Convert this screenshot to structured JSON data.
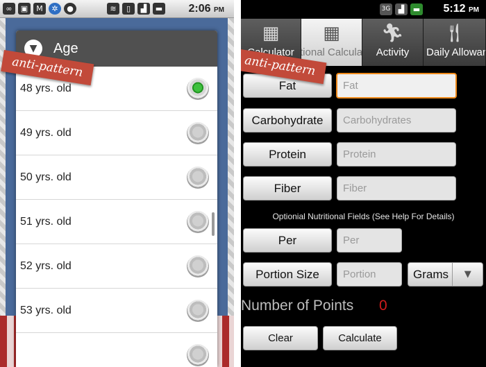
{
  "left": {
    "status_bar": {
      "icons": [
        "voicemail-icon",
        "photo-icon",
        "gmail-icon",
        "settings-icon",
        "media-icon",
        "wifi-icon",
        "vibrate-icon",
        "signal-icon",
        "battery-icon"
      ],
      "time": "2:06",
      "ampm": "PM"
    },
    "dialog": {
      "title": "Age",
      "items": [
        {
          "label": "48 yrs. old",
          "selected": true
        },
        {
          "label": "49 yrs. old",
          "selected": false
        },
        {
          "label": "50 yrs. old",
          "selected": false
        },
        {
          "label": "51 yrs. old",
          "selected": false
        },
        {
          "label": "52 yrs. old",
          "selected": false
        },
        {
          "label": "53 yrs. old",
          "selected": false
        }
      ]
    },
    "tag": "anti-pattern"
  },
  "right": {
    "status_bar": {
      "icons": [
        "3g-icon",
        "signal-icon",
        "battery-icon"
      ],
      "network": "3G",
      "time": "5:12",
      "ampm": "PM"
    },
    "tabs": [
      {
        "label": "Calculator",
        "icon": "calculator-icon",
        "active": false
      },
      {
        "label": "Optional Calculator",
        "icon": "calculator-icon",
        "active": true
      },
      {
        "label": "Activity",
        "icon": "runner-icon",
        "active": false
      },
      {
        "label": "Daily Allowance",
        "icon": "fork-knife-icon",
        "active": false
      }
    ],
    "fields": [
      {
        "button": "Fat",
        "placeholder": "Fat"
      },
      {
        "button": "Carbohydrate",
        "placeholder": "Carbohydrates"
      },
      {
        "button": "Protein",
        "placeholder": "Protein"
      },
      {
        "button": "Fiber",
        "placeholder": "Fiber"
      }
    ],
    "optional_note": "Optionial Nutritional Fields (See Help For Details)",
    "per": {
      "button": "Per",
      "placeholder": "Per"
    },
    "portion": {
      "button": "Portion Size",
      "placeholder": "Portion"
    },
    "unit_select": {
      "value": "Grams"
    },
    "points": {
      "label": "Number of Points",
      "value": "0"
    },
    "clear_label": "Clear",
    "calculate_label": "Calculate",
    "tag": "anti-pattern",
    "colors": {
      "focus": "#f08a1a",
      "points_value": "#d01c1c"
    }
  }
}
